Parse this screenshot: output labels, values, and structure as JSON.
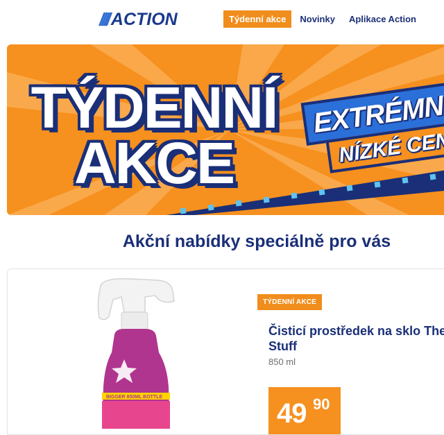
{
  "header": {
    "logo_text": "ACTION",
    "nav": [
      {
        "label": "Týdenní akce",
        "active": true
      },
      {
        "label": "Novinky",
        "active": false
      },
      {
        "label": "Aplikace Action",
        "active": false
      }
    ]
  },
  "banner": {
    "title_line1": "TÝDENNÍ",
    "title_line2": "AKCE",
    "badge_line1": "EXTRÉMN",
    "badge_line2": "NÍZKÉ CENY"
  },
  "section": {
    "title": "Akční nabídky speciálně pro vás"
  },
  "product": {
    "badge": "TÝDENNÍ AKCE",
    "name": "Čisticí prostředek na sklo The Stuff",
    "size": "850 ml",
    "price_int": "49",
    "price_dec": "90",
    "bottle_label": "BIGGER 850ML BOTTLE"
  },
  "colors": {
    "brand_blue": "#1a2f78",
    "accent_orange": "#f6901e",
    "logo_blue": "#2e6bd1"
  }
}
